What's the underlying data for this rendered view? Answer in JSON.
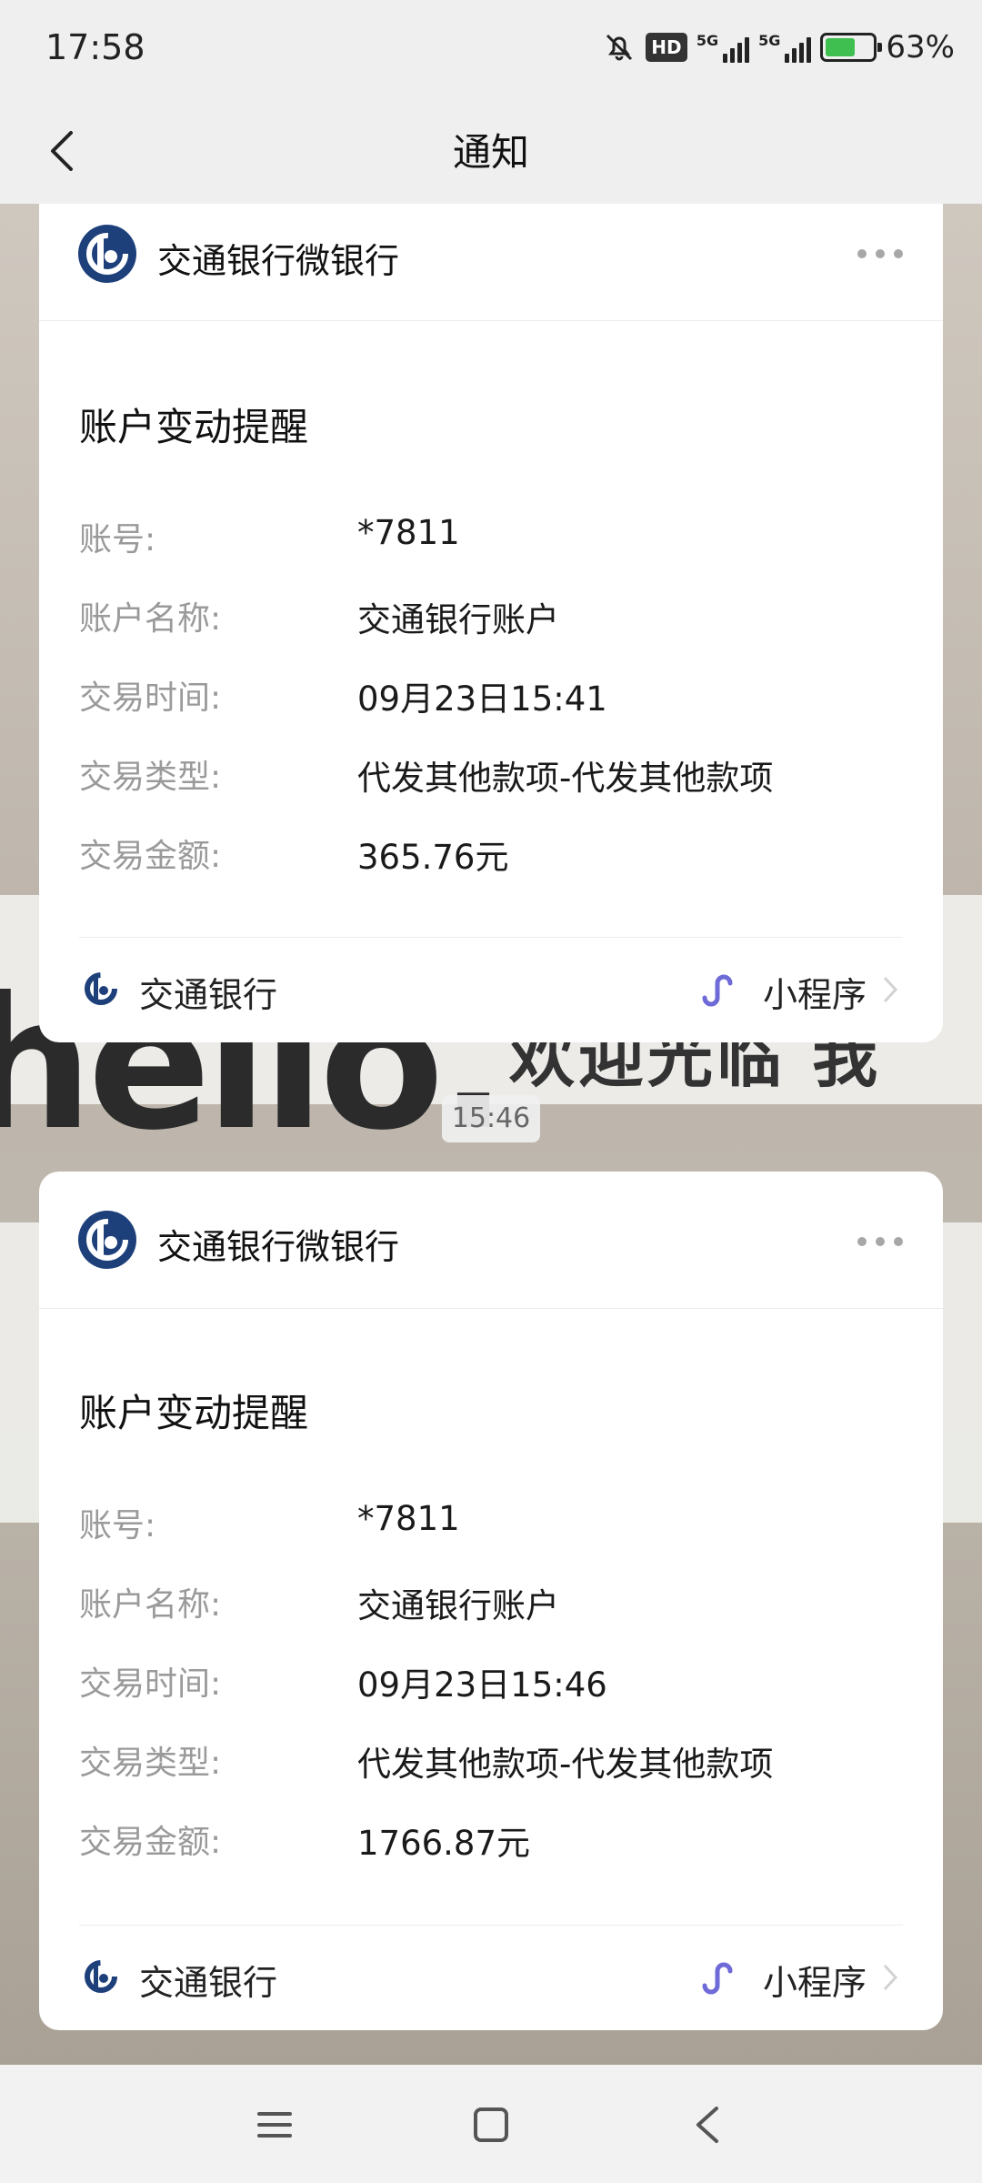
{
  "status": {
    "time": "17:58",
    "hd_badge": "HD",
    "network1": "5G",
    "network2": "5G",
    "battery_percent": "63%",
    "battery_level": 0.63
  },
  "header": {
    "title": "通知"
  },
  "cards": [
    {
      "sender": "交通银行微银行",
      "notice_title": "账户变动提醒",
      "fields": [
        {
          "label": "账号:",
          "value": "*7811"
        },
        {
          "label": "账户名称:",
          "value": "交通银行账户"
        },
        {
          "label": "交易时间:",
          "value": "09月23日15:41"
        },
        {
          "label": "交易类型:",
          "value": "代发其他款项-代发其他款项"
        },
        {
          "label": "交易金额:",
          "value": "365.76元"
        }
      ],
      "footer_name": "交通银行",
      "footer_mini": "小程序"
    },
    {
      "sender": "交通银行微银行",
      "notice_title": "账户变动提醒",
      "fields": [
        {
          "label": "账号:",
          "value": "*7811"
        },
        {
          "label": "账户名称:",
          "value": "交通银行账户"
        },
        {
          "label": "交易时间:",
          "value": "09月23日15:46"
        },
        {
          "label": "交易类型:",
          "value": "代发其他款项-代发其他款项"
        },
        {
          "label": "交易金额:",
          "value": "1766.87元"
        }
      ],
      "footer_name": "交通银行",
      "footer_mini": "小程序"
    }
  ],
  "time_divider": "15:46",
  "background_text": {
    "latin": "hello.",
    "chinese": "欢迎光临 我"
  },
  "colors": {
    "brand_blue": "#1d3f7a",
    "mini_program_purple": "#6e6bd8",
    "battery_green": "#3fbf4f"
  },
  "icons": {
    "back": "chevron-left-icon",
    "more": "more-dots-icon",
    "bank_logo": "bocom-logo-icon",
    "mini_program": "mini-program-link-icon",
    "nav_menu": "menu-icon",
    "nav_home": "home-square-icon",
    "nav_back": "nav-back-icon"
  }
}
